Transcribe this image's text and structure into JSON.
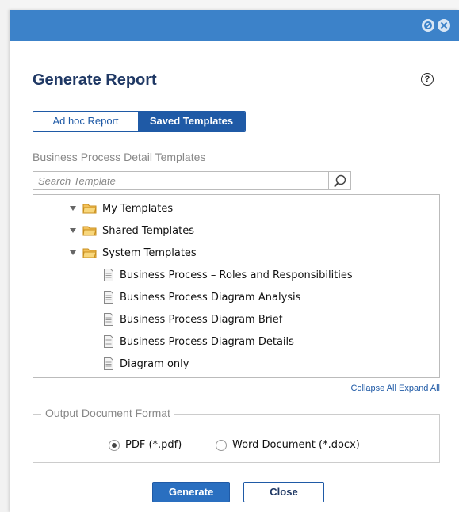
{
  "dialog": {
    "title": "Generate Report",
    "help_icon": "question-circle-icon",
    "title_icons": [
      "block-icon",
      "close-icon"
    ]
  },
  "mode_tabs": {
    "adhoc_label": "Ad hoc Report",
    "saved_label": "Saved Templates",
    "selected": "Saved Templates"
  },
  "templates": {
    "section_label": "Business Process Detail Templates",
    "search_placeholder": "Search Template",
    "search_icon": "search-icon",
    "tree": {
      "folders": [
        {
          "label": "My Templates",
          "expanded": true
        },
        {
          "label": "Shared Templates",
          "expanded": true
        },
        {
          "label": "System Templates",
          "expanded": true
        }
      ],
      "system_items": [
        "Business Process – Roles and Responsibilities",
        "Business Process Diagram Analysis",
        "Business Process Diagram Brief",
        "Business Process Diagram Details",
        "Diagram only"
      ]
    },
    "collapse_all": "Collapse All",
    "expand_all": "Expand All"
  },
  "output_format": {
    "legend": "Output Document Format",
    "options": [
      "PDF (*.pdf)",
      "Word Document (*.docx)"
    ],
    "selected": "PDF (*.pdf)"
  },
  "actions": {
    "generate_label": "Generate",
    "close_label": "Close"
  },
  "colors": {
    "titlebar": "#3c82c9",
    "accent": "#1f5aa6",
    "title_text": "#1f3864"
  }
}
